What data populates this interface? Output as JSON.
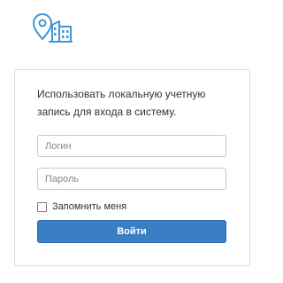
{
  "logo": {
    "icon": "location-pin-buildings-icon",
    "color": "#3f95d6"
  },
  "login": {
    "intro_text": "Использовать локальную учетную запись для входа в систему.",
    "username_placeholder": "Логин",
    "username_value": "",
    "password_placeholder": "Пароль",
    "password_value": "",
    "remember_label": "Запомнить меня",
    "remember_checked": false,
    "submit_label": "Войти",
    "button_color": "#3a7fc3"
  }
}
